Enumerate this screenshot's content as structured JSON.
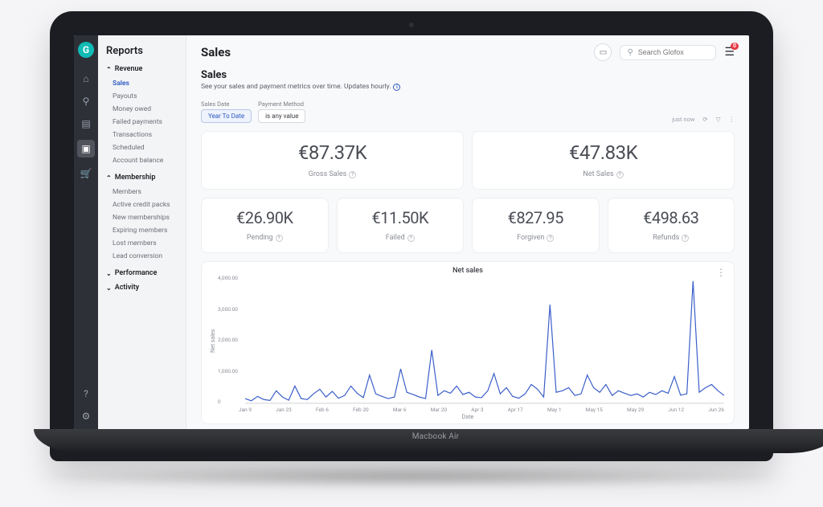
{
  "device": {
    "label": "Macbook Air"
  },
  "iconbar": {
    "logo": "G",
    "icons": [
      "home-icon",
      "search-icon",
      "clipboard-icon",
      "reports-icon",
      "cart-icon"
    ],
    "bottom": [
      "help-icon",
      "settings-icon"
    ]
  },
  "sidepanel": {
    "title": "Reports",
    "sections": [
      {
        "label": "Revenue",
        "open": true,
        "items": [
          "Sales",
          "Payouts",
          "Money owed",
          "Failed payments",
          "Transactions",
          "Scheduled",
          "Account balance"
        ],
        "selected": "Sales"
      },
      {
        "label": "Membership",
        "open": true,
        "items": [
          "Members",
          "Active credit packs",
          "New memberships",
          "Expiring members",
          "Lost members",
          "Lead conversion"
        ]
      },
      {
        "label": "Performance",
        "open": false,
        "items": []
      },
      {
        "label": "Activity",
        "open": false,
        "items": []
      }
    ]
  },
  "topbar": {
    "title": "Sales",
    "search_placeholder": "Search Glofox",
    "badge": "0"
  },
  "panel": {
    "heading": "Sales",
    "description": "See your sales and payment metrics over time. Updates hourly.",
    "filters": {
      "sales_date_label": "Sales Date",
      "sales_date_value": "Year To Date",
      "payment_method_label": "Payment Method",
      "payment_method_value": "is any value",
      "timestamp": "just now"
    },
    "metrics_top": [
      {
        "value": "€87.37K",
        "label": "Gross Sales"
      },
      {
        "value": "€47.83K",
        "label": "Net Sales"
      }
    ],
    "metrics_bottom": [
      {
        "value": "€26.90K",
        "label": "Pending"
      },
      {
        "value": "€11.50K",
        "label": "Failed"
      },
      {
        "value": "€827.95",
        "label": "Forgiven"
      },
      {
        "value": "€498.63",
        "label": "Refunds"
      }
    ]
  },
  "chart_data": {
    "type": "line",
    "title": "Net sales",
    "xlabel": "Date",
    "ylabel": "Net sales",
    "ylim": [
      0,
      4000
    ],
    "y_ticks": [
      "0",
      "1,000.00",
      "2,000.00",
      "3,000.00",
      "4,000.00"
    ],
    "x_ticks": [
      "Jan 9",
      "Jan 23",
      "Feb 6",
      "Feb 20",
      "Mar 6",
      "Mar 20",
      "Apr 3",
      "Apr 17",
      "May 1",
      "May 15",
      "May 29",
      "Jun 12",
      "Jun 26"
    ],
    "values": [
      150,
      80,
      220,
      120,
      90,
      400,
      200,
      100,
      550,
      150,
      120,
      300,
      450,
      200,
      380,
      160,
      250,
      550,
      320,
      180,
      900,
      300,
      220,
      150,
      200,
      1100,
      350,
      280,
      200,
      150,
      1700,
      250,
      400,
      320,
      550,
      280,
      350,
      200,
      180,
      400,
      950,
      300,
      500,
      220,
      160,
      300,
      600,
      450,
      200,
      3150,
      350,
      400,
      500,
      250,
      300,
      900,
      500,
      350,
      600,
      250,
      400,
      320,
      250,
      300,
      200,
      350,
      280,
      400,
      320,
      850,
      260,
      300,
      3900,
      350,
      500,
      600,
      400,
      250
    ]
  }
}
